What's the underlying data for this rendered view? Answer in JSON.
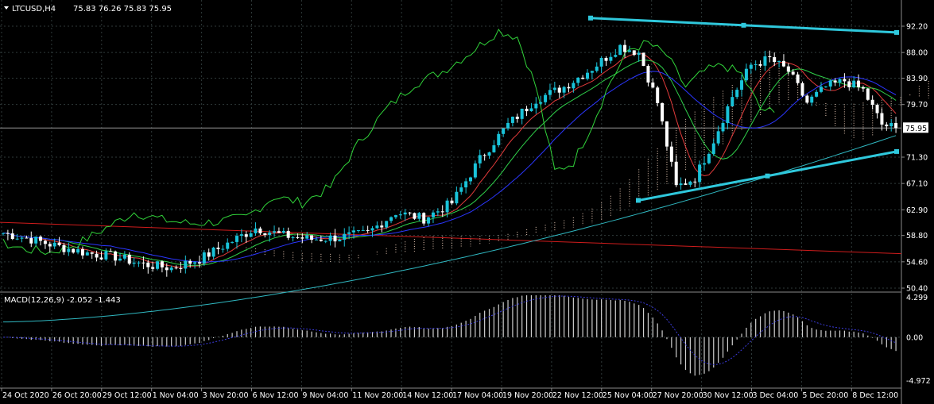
{
  "header": {
    "symbol": "LTCUSD,H4",
    "ohlc": "75.83 76.26 75.83 75.95"
  },
  "indicator": {
    "label": "MACD(12,26,9) -2.052 -1.443"
  },
  "colors": {
    "background": "#000000",
    "grid": "#2f3a3a",
    "bull_candle": "#19c3d9",
    "bear_candle": "#ffffff",
    "trendline": "#2fc8dc",
    "cloud": "#e8c9b6",
    "ma_red": "#e33b3b",
    "ma_blue": "#2b36ff",
    "ma_green": "#2fd04a",
    "chikou": "#31d43a",
    "ma200": "#2fb7c0",
    "ma_long_red": "#d01c1c",
    "macd_hist": "#cfcfcf",
    "macd_signal": "#3a3ad8"
  },
  "chart_data": {
    "type": "candlestick",
    "title": "LTCUSD,H4",
    "price_axis": {
      "ticks": [
        "92.20",
        "88.00",
        "83.90",
        "79.70",
        "75.95",
        "71.30",
        "67.10",
        "62.90",
        "58.80",
        "54.60",
        "50.40"
      ],
      "current_price": "75.95",
      "ylim": [
        50.4,
        92.2
      ]
    },
    "time_axis": {
      "labels": [
        "24 Oct 2020",
        "26 Oct 20:00",
        "29 Oct 12:00",
        "1 Nov 04:00",
        "3 Nov 20:00",
        "6 Nov 12:00",
        "9 Nov 04:00",
        "11 Nov 20:00",
        "14 Nov 12:00",
        "17 Nov 04:00",
        "19 Nov 20:00",
        "22 Nov 12:00",
        "25 Nov 04:00",
        "27 Nov 20:00",
        "30 Nov 12:00",
        "3 Dec 04:00",
        "5 Dec 20:00",
        "8 Dec 12:00"
      ]
    },
    "macd_axis": {
      "ticks": [
        "4.299",
        "0.00",
        "-4.972"
      ],
      "ylim": [
        -4.972,
        4.299
      ]
    },
    "trendlines": [
      {
        "name": "upper",
        "from": [
          "22 Nov 12:00",
          93.5
        ],
        "to": [
          "8 Dec 12:00",
          91.2
        ]
      },
      {
        "name": "lower",
        "from": [
          "25 Nov 04:00",
          64.4
        ],
        "to": [
          "8 Dec 12:00",
          72.2
        ]
      }
    ],
    "price_path": [
      [
        0,
        59.2
      ],
      [
        6,
        58.2
      ],
      [
        12,
        57.0
      ],
      [
        18,
        56.0
      ],
      [
        24,
        55.4
      ],
      [
        30,
        54.2
      ],
      [
        36,
        53.6
      ],
      [
        42,
        55.0
      ],
      [
        48,
        57.5
      ],
      [
        54,
        60.0
      ],
      [
        60,
        58.8
      ],
      [
        66,
        58.2
      ],
      [
        72,
        58.5
      ],
      [
        78,
        59.2
      ],
      [
        84,
        62.5
      ],
      [
        90,
        61.5
      ],
      [
        96,
        64.0
      ],
      [
        102,
        71.0
      ],
      [
        108,
        76.5
      ],
      [
        114,
        80.5
      ],
      [
        120,
        82.5
      ],
      [
        126,
        85.5
      ],
      [
        132,
        89.0
      ],
      [
        136,
        88.0
      ],
      [
        140,
        80.0
      ],
      [
        144,
        66.5
      ],
      [
        148,
        68.0
      ],
      [
        152,
        74.0
      ],
      [
        156,
        81.0
      ],
      [
        160,
        86.0
      ],
      [
        164,
        87.0
      ],
      [
        168,
        85.0
      ],
      [
        172,
        80.0
      ],
      [
        176,
        82.5
      ],
      [
        180,
        83.5
      ],
      [
        184,
        82.0
      ],
      [
        188,
        76.5
      ],
      [
        191,
        75.95
      ]
    ]
  }
}
